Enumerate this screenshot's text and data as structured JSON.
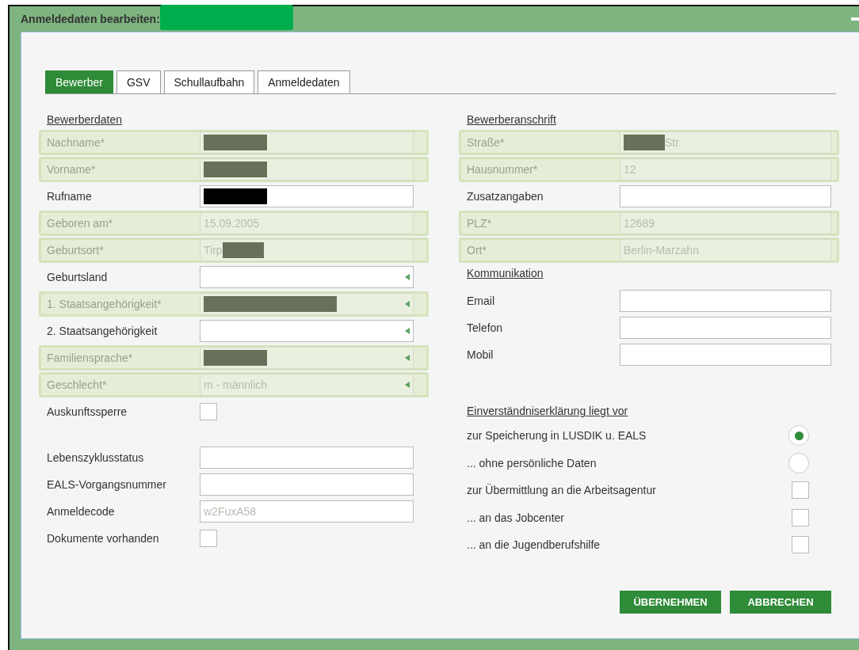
{
  "window": {
    "title": "Anmeldedaten bearbeiten:",
    "title_redacted": true
  },
  "tabs": [
    {
      "label": "Bewerber",
      "selected": true
    },
    {
      "label": "GSV",
      "selected": false
    },
    {
      "label": "Schullaufbahn",
      "selected": false
    },
    {
      "label": "Anmeldedaten",
      "selected": false
    }
  ],
  "applicant": {
    "heading": "Bewerberdaten",
    "fields": [
      {
        "kind": "text",
        "label": "Nachname*",
        "disabled": true,
        "redacted": true
      },
      {
        "kind": "text",
        "label": "Vorname*",
        "disabled": true,
        "redacted": true
      },
      {
        "kind": "text",
        "label": "Rufname",
        "disabled": false,
        "redacted": true
      },
      {
        "kind": "text",
        "label": "Geboren am*",
        "value": "15.09.2005",
        "disabled": true
      },
      {
        "kind": "text",
        "label": "Geburtsort*",
        "value": "Tirp",
        "disabled": true,
        "redacted": true,
        "redacted_after_value": true
      },
      {
        "kind": "select",
        "label": "Geburtsland",
        "disabled": false
      },
      {
        "kind": "select",
        "label": "1. Staatsangehörigkeit*",
        "disabled": true,
        "redacted": true,
        "redaction_long": true
      },
      {
        "kind": "select",
        "label": "2. Staatsangehörigkeit",
        "disabled": false
      },
      {
        "kind": "select",
        "label": "Familiensprache*",
        "disabled": true,
        "redacted": true
      },
      {
        "kind": "select",
        "label": "Geschlecht*",
        "value": "m - männlich",
        "disabled": true
      },
      {
        "kind": "checkbox",
        "label": "Auskunftssperre",
        "checked": false
      },
      {
        "kind": "spacer"
      },
      {
        "kind": "text",
        "label": "Lebenszyklusstatus",
        "disabled": false
      },
      {
        "kind": "text",
        "label": "EALS-Vorgangsnummer",
        "disabled": false
      },
      {
        "kind": "text",
        "label": "Anmeldecode",
        "value": "w2FuxA58",
        "disabled": false,
        "greyed": true
      },
      {
        "kind": "checkbox",
        "label": "Dokumente vorhanden",
        "checked": false
      }
    ]
  },
  "address": {
    "heading": "Bewerberanschrift",
    "fields": [
      {
        "kind": "text",
        "label": "Straße*",
        "value": "Str.",
        "disabled": true,
        "redacted": true
      },
      {
        "kind": "text",
        "label": "Hausnummer*",
        "value": "12",
        "disabled": true
      },
      {
        "kind": "text",
        "label": "Zusatzangaben",
        "disabled": false
      },
      {
        "kind": "text",
        "label": "PLZ*",
        "value": "12689",
        "disabled": true
      },
      {
        "kind": "text",
        "label": "Ort*",
        "value": "Berlin-Marzahn",
        "disabled": true
      }
    ]
  },
  "communication": {
    "heading": "Kommunikation",
    "fields": [
      {
        "kind": "text",
        "label": "Email",
        "disabled": false
      },
      {
        "kind": "text",
        "label": "Telefon",
        "disabled": false
      },
      {
        "kind": "text",
        "label": "Mobil",
        "disabled": false
      }
    ]
  },
  "consent": {
    "heading": "Einverständniserklärung liegt vor",
    "items": [
      {
        "kind": "radio",
        "label": "zur Speicherung in LUSDIK u. EALS",
        "selected": true
      },
      {
        "kind": "radio",
        "label": "... ohne persönliche Daten",
        "selected": false
      },
      {
        "kind": "checkbox",
        "label": "zur Übermittlung an die Arbeitsagentur",
        "checked": false
      },
      {
        "kind": "checkbox",
        "label": "... an das Jobcenter",
        "checked": false
      },
      {
        "kind": "checkbox",
        "label": "... an die Jugendberufshilfe",
        "checked": false
      }
    ]
  },
  "buttons": [
    "ÜBERNEHMEN",
    "ABBRECHEN"
  ]
}
